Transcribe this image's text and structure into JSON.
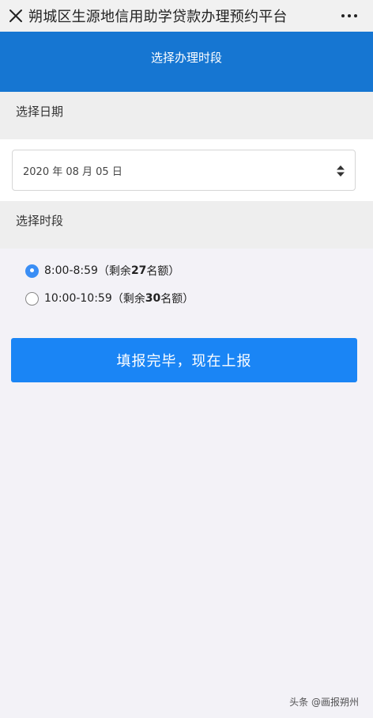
{
  "topbar": {
    "title": "朔城区生源地信用助学贷款办理预约平台",
    "close_icon": "close-icon",
    "more_icon": "more-dots-icon"
  },
  "header": {
    "title": "选择办理时段"
  },
  "date_section": {
    "label": "选择日期",
    "selected_value": "2020 年 08 月 05 日"
  },
  "time_section": {
    "label": "选择时段",
    "slots": [
      {
        "time": "8:00-8:59",
        "prefix": "（剩余 ",
        "count": "27",
        "suffix": " 名额）",
        "checked": true
      },
      {
        "time": "10:00-10:59",
        "prefix": "（剩余 ",
        "count": "30",
        "suffix": " 名额）",
        "checked": false
      }
    ]
  },
  "submit_label": "填报完毕，现在上报",
  "watermark": "头条 @画报朔州",
  "colors": {
    "header_bg": "#1676d2",
    "button_bg": "#1a85f5",
    "radio_checked": "#3a8ef5"
  }
}
